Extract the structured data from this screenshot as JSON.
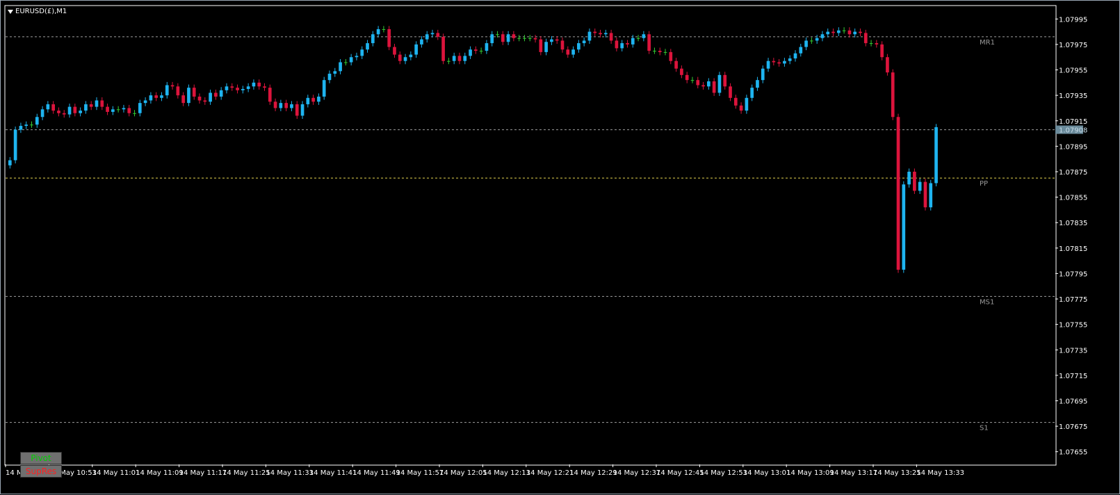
{
  "window": {
    "title": "EURUSD(£),M1"
  },
  "buttons": {
    "pivot": "Pivot",
    "supres": "SupRes"
  },
  "colors": {
    "background": "#000000",
    "bull": "#1eb4f0",
    "bear": "#dc143c",
    "doji": "#32cd32",
    "axis": "#ffffff",
    "level_line": "#a0a0a0",
    "pp_line": "#e6d650",
    "current_price_box": "#6a8a9a"
  },
  "chart_data": {
    "type": "candlestick",
    "symbol": "EURUSD(£)",
    "timeframe": "M1",
    "ylim": [
      1.07645,
      1.08005
    ],
    "y_ticks": [
      "1.07995",
      "1.07975",
      "1.07955",
      "1.07935",
      "1.07915",
      "1.07895",
      "1.07875",
      "1.07855",
      "1.07835",
      "1.07815",
      "1.07795",
      "1.07775",
      "1.07755",
      "1.07735",
      "1.07715",
      "1.07695",
      "1.07675",
      "1.07655"
    ],
    "x_labels": [
      "14 May 2024",
      "14 May 10:53",
      "14 May 11:01",
      "14 May 11:09",
      "14 May 11:17",
      "14 May 11:25",
      "14 May 11:33",
      "14 May 11:41",
      "14 May 11:49",
      "14 May 11:57",
      "14 May 12:05",
      "14 May 12:13",
      "14 May 12:21",
      "14 May 12:29",
      "14 May 12:37",
      "14 May 12:45",
      "14 May 12:53",
      "14 May 13:01",
      "14 May 13:09",
      "14 May 13:17",
      "14 May 13:25",
      "14 May 13:33"
    ],
    "levels": [
      {
        "name": "MR1",
        "value": 1.07981,
        "style": "level"
      },
      {
        "name": "",
        "value": 1.07908,
        "style": "level"
      },
      {
        "name": "PP",
        "value": 1.0787,
        "style": "pp"
      },
      {
        "name": "MS1",
        "value": 1.07777,
        "style": "level"
      },
      {
        "name": "S1",
        "value": 1.07678,
        "style": "level"
      }
    ],
    "current_price": {
      "value": 1.07908,
      "label": "1.07908"
    },
    "closes": [
      1.07884,
      1.07908,
      1.07911,
      1.07912,
      1.07912,
      1.07918,
      1.07924,
      1.07928,
      1.07923,
      1.07921,
      1.0792,
      1.07926,
      1.07921,
      1.07923,
      1.07928,
      1.07926,
      1.07931,
      1.07926,
      1.07922,
      1.07924,
      1.07924,
      1.07925,
      1.07921,
      1.07921,
      1.07929,
      1.07931,
      1.07935,
      1.07933,
      1.07935,
      1.07943,
      1.07942,
      1.07935,
      1.07929,
      1.07941,
      1.07934,
      1.07931,
      1.0793,
      1.07937,
      1.07934,
      1.07939,
      1.07942,
      1.07941,
      1.07939,
      1.0794,
      1.07942,
      1.07945,
      1.07942,
      1.07941,
      1.0793,
      1.07925,
      1.07929,
      1.07925,
      1.07928,
      1.07919,
      1.07928,
      1.07933,
      1.0793,
      1.07934,
      1.07947,
      1.07952,
      1.07954,
      1.07961,
      1.07961,
      1.07965,
      1.07966,
      1.07971,
      1.07976,
      1.07983,
      1.07987,
      1.07987,
      1.07973,
      1.07967,
      1.07962,
      1.07965,
      1.07967,
      1.07975,
      1.07979,
      1.07983,
      1.07984,
      1.07981,
      1.07962,
      1.07962,
      1.07966,
      1.07962,
      1.07966,
      1.07971,
      1.0797,
      1.0797,
      1.07976,
      1.07983,
      1.07983,
      1.07977,
      1.07983,
      1.0798,
      1.0798,
      1.0798,
      1.0798,
      1.07979,
      1.07969,
      1.07977,
      1.07979,
      1.07978,
      1.07971,
      1.07967,
      1.07971,
      1.07976,
      1.07978,
      1.07985,
      1.07984,
      1.07983,
      1.07984,
      1.07978,
      1.07972,
      1.07976,
      1.07975,
      1.0798,
      1.0798,
      1.07983,
      1.0797,
      1.0797,
      1.07969,
      1.07969,
      1.07962,
      1.07956,
      1.07951,
      1.07947,
      1.07947,
      1.07943,
      1.07942,
      1.07946,
      1.07937,
      1.07951,
      1.07942,
      1.07933,
      1.07927,
      1.07923,
      1.07933,
      1.07941,
      1.07947,
      1.07956,
      1.07962,
      1.07961,
      1.0796,
      1.07962,
      1.07964,
      1.07968,
      1.07973,
      1.07978,
      1.07978,
      1.0798,
      1.07983,
      1.07985,
      1.07984,
      1.07986,
      1.07986,
      1.07983,
      1.07985,
      1.07984,
      1.07976,
      1.07976,
      1.07975,
      1.07965,
      1.07953,
      1.07918,
      1.07798,
      1.07865,
      1.07875,
      1.0786,
      1.07867,
      1.07847,
      1.07866,
      1.0791
    ]
  }
}
